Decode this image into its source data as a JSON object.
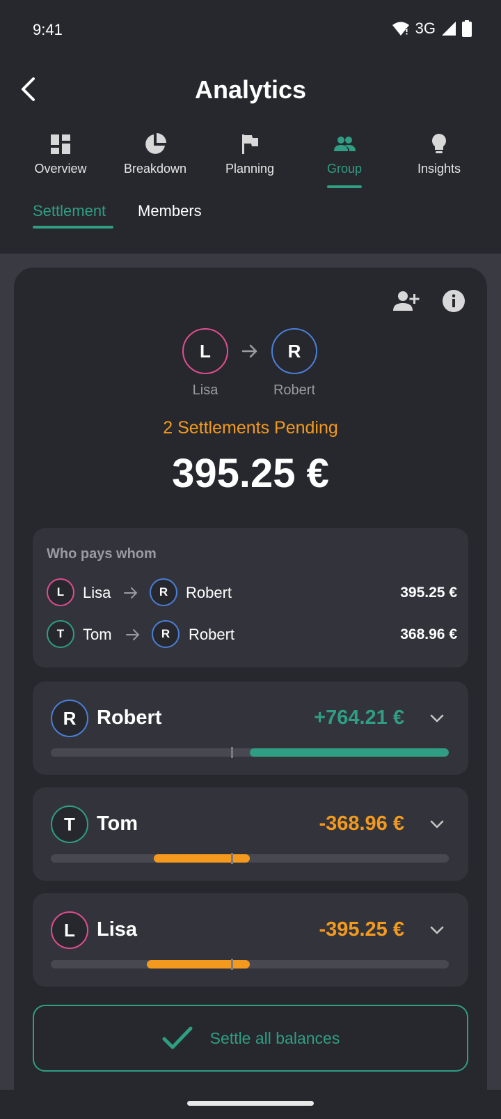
{
  "status": {
    "time": "9:41",
    "network": "3G"
  },
  "header": {
    "title": "Analytics"
  },
  "tabs": [
    {
      "label": "Overview",
      "icon": "dashboard-icon"
    },
    {
      "label": "Breakdown",
      "icon": "pie-chart-icon"
    },
    {
      "label": "Planning",
      "icon": "flag-icon"
    },
    {
      "label": "Group",
      "icon": "group-icon",
      "active": true
    },
    {
      "label": "Insights",
      "icon": "lightbulb-icon"
    }
  ],
  "subtabs": [
    {
      "label": "Settlement",
      "active": true
    },
    {
      "label": "Members"
    }
  ],
  "hero": {
    "from": {
      "initial": "L",
      "name": "Lisa"
    },
    "to": {
      "initial": "R",
      "name": "Robert"
    },
    "pending": "2 Settlements Pending",
    "total": "395.25 €"
  },
  "who": {
    "title": "Who pays whom",
    "rows": [
      {
        "from_initial": "L",
        "from": "Lisa",
        "to_initial": "R",
        "to": "Robert",
        "amount": "395.25 €"
      },
      {
        "from_initial": "T",
        "from": "Tom",
        "to_initial": "R",
        "to": "Robert",
        "amount": "368.96 €"
      }
    ]
  },
  "members": [
    {
      "initial": "R",
      "name": "Robert",
      "amount": "+764.21 €",
      "balance": 764.21
    },
    {
      "initial": "T",
      "name": "Tom",
      "amount": "-368.96 €",
      "balance": -368.96
    },
    {
      "initial": "L",
      "name": "Lisa",
      "amount": "-395.25 €",
      "balance": -395.25
    }
  ],
  "balance_scale_max": 764.21,
  "settle": {
    "label": "Settle all balances"
  },
  "colors": {
    "accent": "#2f9e82",
    "warning": "#f39a1e",
    "pink": "#e04d8f",
    "blue": "#4a7fd6"
  }
}
